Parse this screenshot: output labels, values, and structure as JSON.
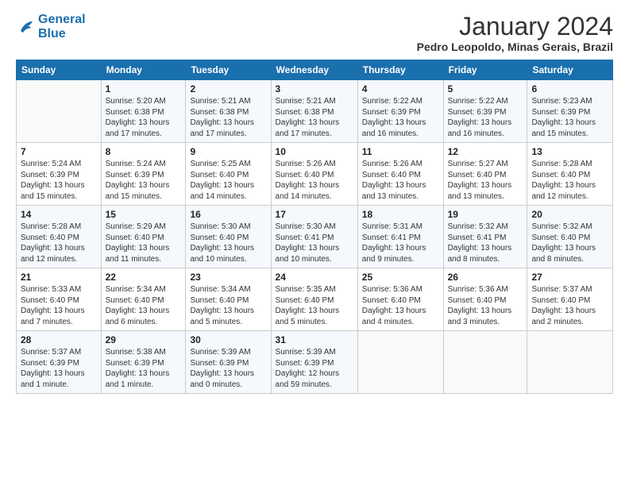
{
  "logo": {
    "line1": "General",
    "line2": "Blue"
  },
  "title": "January 2024",
  "subtitle": "Pedro Leopoldo, Minas Gerais, Brazil",
  "days_header": [
    "Sunday",
    "Monday",
    "Tuesday",
    "Wednesday",
    "Thursday",
    "Friday",
    "Saturday"
  ],
  "weeks": [
    [
      {
        "num": "",
        "info": ""
      },
      {
        "num": "1",
        "info": "Sunrise: 5:20 AM\nSunset: 6:38 PM\nDaylight: 13 hours\nand 17 minutes."
      },
      {
        "num": "2",
        "info": "Sunrise: 5:21 AM\nSunset: 6:38 PM\nDaylight: 13 hours\nand 17 minutes."
      },
      {
        "num": "3",
        "info": "Sunrise: 5:21 AM\nSunset: 6:38 PM\nDaylight: 13 hours\nand 17 minutes."
      },
      {
        "num": "4",
        "info": "Sunrise: 5:22 AM\nSunset: 6:39 PM\nDaylight: 13 hours\nand 16 minutes."
      },
      {
        "num": "5",
        "info": "Sunrise: 5:22 AM\nSunset: 6:39 PM\nDaylight: 13 hours\nand 16 minutes."
      },
      {
        "num": "6",
        "info": "Sunrise: 5:23 AM\nSunset: 6:39 PM\nDaylight: 13 hours\nand 15 minutes."
      }
    ],
    [
      {
        "num": "7",
        "info": "Sunrise: 5:24 AM\nSunset: 6:39 PM\nDaylight: 13 hours\nand 15 minutes."
      },
      {
        "num": "8",
        "info": "Sunrise: 5:24 AM\nSunset: 6:39 PM\nDaylight: 13 hours\nand 15 minutes."
      },
      {
        "num": "9",
        "info": "Sunrise: 5:25 AM\nSunset: 6:40 PM\nDaylight: 13 hours\nand 14 minutes."
      },
      {
        "num": "10",
        "info": "Sunrise: 5:26 AM\nSunset: 6:40 PM\nDaylight: 13 hours\nand 14 minutes."
      },
      {
        "num": "11",
        "info": "Sunrise: 5:26 AM\nSunset: 6:40 PM\nDaylight: 13 hours\nand 13 minutes."
      },
      {
        "num": "12",
        "info": "Sunrise: 5:27 AM\nSunset: 6:40 PM\nDaylight: 13 hours\nand 13 minutes."
      },
      {
        "num": "13",
        "info": "Sunrise: 5:28 AM\nSunset: 6:40 PM\nDaylight: 13 hours\nand 12 minutes."
      }
    ],
    [
      {
        "num": "14",
        "info": "Sunrise: 5:28 AM\nSunset: 6:40 PM\nDaylight: 13 hours\nand 12 minutes."
      },
      {
        "num": "15",
        "info": "Sunrise: 5:29 AM\nSunset: 6:40 PM\nDaylight: 13 hours\nand 11 minutes."
      },
      {
        "num": "16",
        "info": "Sunrise: 5:30 AM\nSunset: 6:40 PM\nDaylight: 13 hours\nand 10 minutes."
      },
      {
        "num": "17",
        "info": "Sunrise: 5:30 AM\nSunset: 6:41 PM\nDaylight: 13 hours\nand 10 minutes."
      },
      {
        "num": "18",
        "info": "Sunrise: 5:31 AM\nSunset: 6:41 PM\nDaylight: 13 hours\nand 9 minutes."
      },
      {
        "num": "19",
        "info": "Sunrise: 5:32 AM\nSunset: 6:41 PM\nDaylight: 13 hours\nand 8 minutes."
      },
      {
        "num": "20",
        "info": "Sunrise: 5:32 AM\nSunset: 6:40 PM\nDaylight: 13 hours\nand 8 minutes."
      }
    ],
    [
      {
        "num": "21",
        "info": "Sunrise: 5:33 AM\nSunset: 6:40 PM\nDaylight: 13 hours\nand 7 minutes."
      },
      {
        "num": "22",
        "info": "Sunrise: 5:34 AM\nSunset: 6:40 PM\nDaylight: 13 hours\nand 6 minutes."
      },
      {
        "num": "23",
        "info": "Sunrise: 5:34 AM\nSunset: 6:40 PM\nDaylight: 13 hours\nand 5 minutes."
      },
      {
        "num": "24",
        "info": "Sunrise: 5:35 AM\nSunset: 6:40 PM\nDaylight: 13 hours\nand 5 minutes."
      },
      {
        "num": "25",
        "info": "Sunrise: 5:36 AM\nSunset: 6:40 PM\nDaylight: 13 hours\nand 4 minutes."
      },
      {
        "num": "26",
        "info": "Sunrise: 5:36 AM\nSunset: 6:40 PM\nDaylight: 13 hours\nand 3 minutes."
      },
      {
        "num": "27",
        "info": "Sunrise: 5:37 AM\nSunset: 6:40 PM\nDaylight: 13 hours\nand 2 minutes."
      }
    ],
    [
      {
        "num": "28",
        "info": "Sunrise: 5:37 AM\nSunset: 6:39 PM\nDaylight: 13 hours\nand 1 minute."
      },
      {
        "num": "29",
        "info": "Sunrise: 5:38 AM\nSunset: 6:39 PM\nDaylight: 13 hours\nand 1 minute."
      },
      {
        "num": "30",
        "info": "Sunrise: 5:39 AM\nSunset: 6:39 PM\nDaylight: 13 hours\nand 0 minutes."
      },
      {
        "num": "31",
        "info": "Sunrise: 5:39 AM\nSunset: 6:39 PM\nDaylight: 12 hours\nand 59 minutes."
      },
      {
        "num": "",
        "info": ""
      },
      {
        "num": "",
        "info": ""
      },
      {
        "num": "",
        "info": ""
      }
    ]
  ]
}
